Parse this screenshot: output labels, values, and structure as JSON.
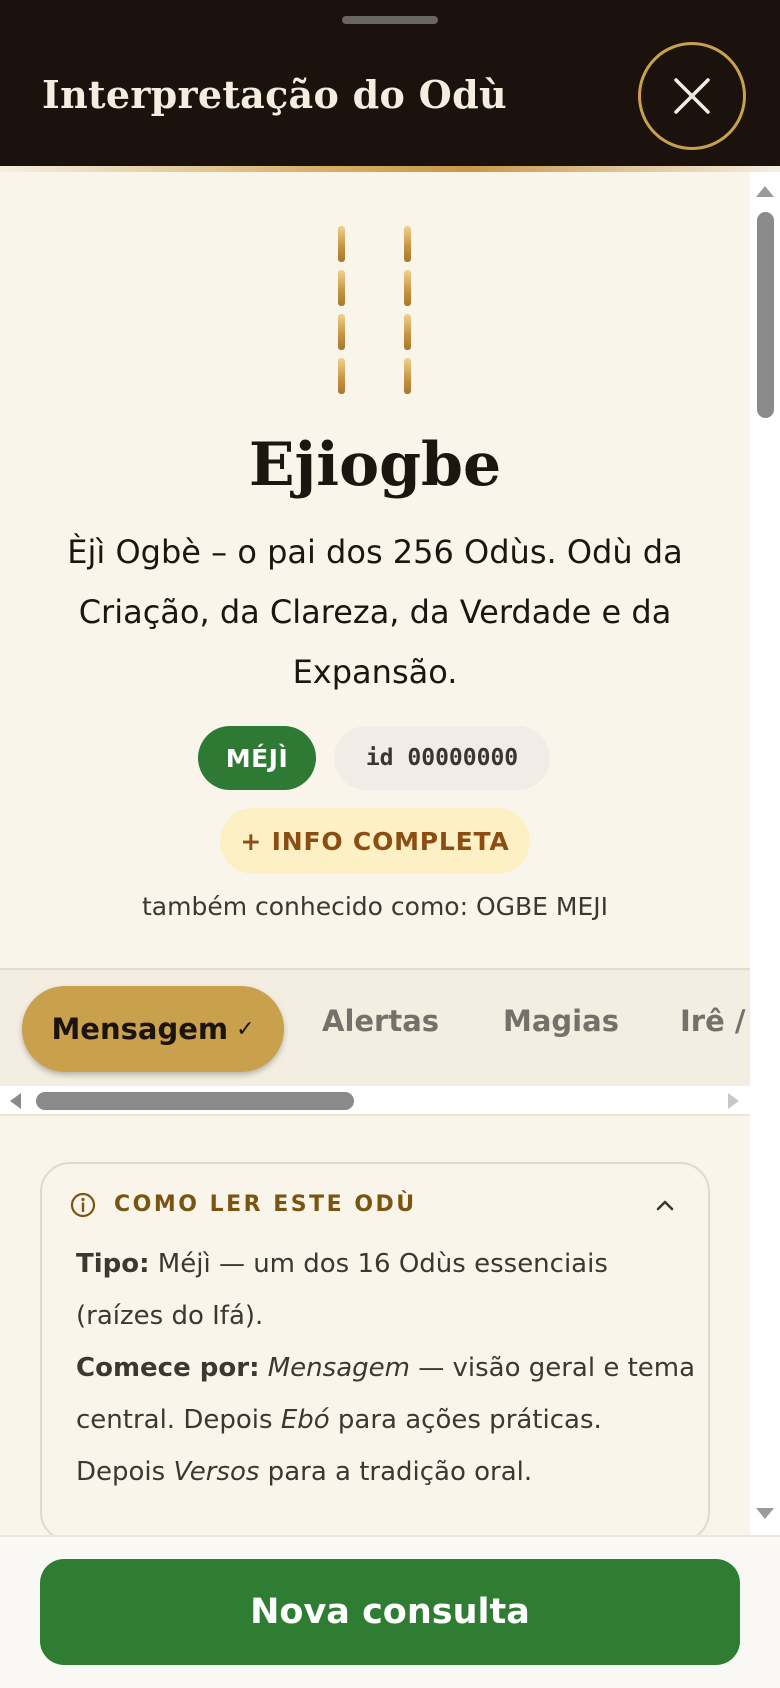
{
  "header": {
    "title": "Interpretação do Odù"
  },
  "odu": {
    "name": "Ejiogbe",
    "description": "Èjì Ogbè – o pai dos 256 Odùs. Odù da Criação, da Clareza, da Verdade e da Expansão.",
    "type_badge": "MÉJÌ",
    "id_badge": "id 00000000",
    "info_button": "+ INFO COMPLETA",
    "aka": "também conhecido como: OGBE MEJI"
  },
  "tabs": [
    {
      "label": "Mensagem",
      "active": true,
      "check": "✓"
    },
    {
      "label": "Alertas"
    },
    {
      "label": "Magias"
    },
    {
      "label": "Irê /"
    }
  ],
  "howto": {
    "title": "COMO LER ESTE ODÙ",
    "type_label": "Tipo:",
    "type_text": "Méjì — um dos 16 Odùs essenciais (raízes do Ifá).",
    "start_label": "Comece por:",
    "start_em1": "Mensagem",
    "start_text1": " — visão geral e tema central. Depois ",
    "start_em2": "Ebó",
    "start_text2": " para ações práticas. Depois ",
    "start_em3": "Versos",
    "start_text3": " para a tradição oral."
  },
  "footer": {
    "button": "Nova consulta"
  },
  "colors": {
    "accent_gold": "#c9a04c",
    "green": "#2e7d33",
    "header_bg": "#1b120d"
  }
}
